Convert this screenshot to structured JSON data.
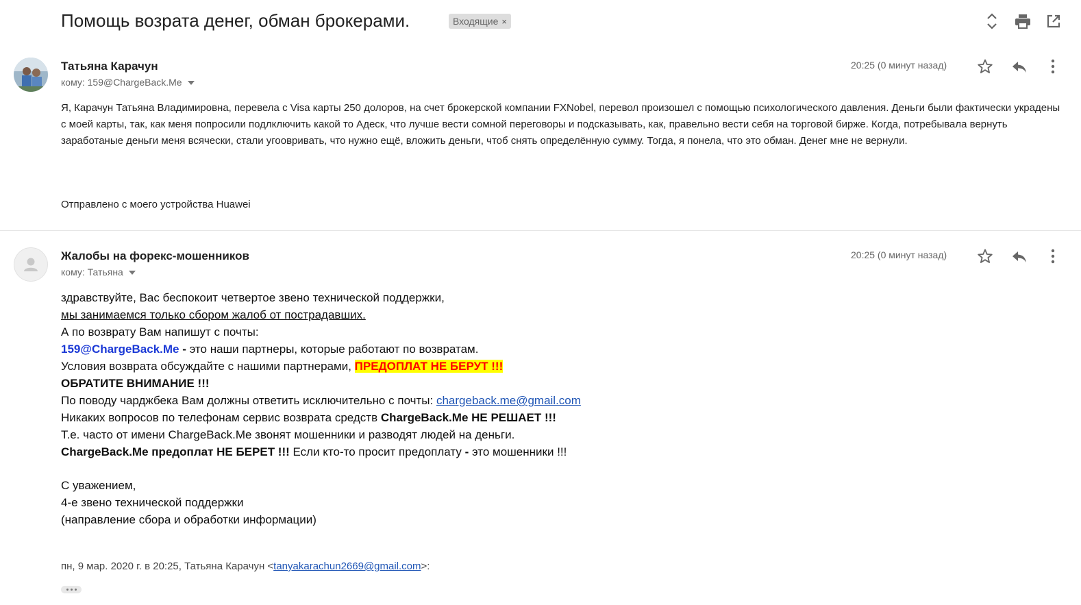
{
  "thread": {
    "subject": "Помощь возрата денег, обман брокерами.",
    "label": "Входящие",
    "label_remove": "×",
    "icons": [
      "expand-collapse-icon",
      "print-icon",
      "open-in-new-window-icon"
    ]
  },
  "messages": [
    {
      "sender": "Татьяна Карачун",
      "to": "кому: 159@ChargeBack.Me",
      "time": "20:25 (0 минут назад)",
      "body": "Я, Карачун Татьяна Владимировна, перевела с Visa карты 250 долоров, на счет брокерской компании FXNobel, перевол произошел с помощью психологического давления. Деньги были фактически украдены с моей карты, так, как меня попросили подлключить какой то Адеск, что лучше вести сомной переговоры и подсказывать, как, правельно вести себя на торговой бирже. Когда, потребывала вернуть заработаные деньги меня всячески, стали угоовривать, что нужно ещё, вложить деньги, чтоб снять определённую сумму. Тогда, я понела, что это обман. Денег мне не вернули.",
      "signature": "Отправлено с моего устройства Huawei"
    },
    {
      "sender": "Жалобы на форекс-мошенников",
      "to": "кому: Татьяна",
      "time": "20:25 (0 минут назад)",
      "lines": {
        "l1": "здравствуйте, Вас беспокоит четвертое звено технической поддержки,",
        "l2": "мы занимаемся только сбором жалоб от пострадавших.",
        "l3": "А по возврату Вам напишут с почты:",
        "l4_email": "159@ChargeBack.Me",
        "l4_dash": " -",
        "l4_rest": " это наши партнеры, которые работают по возвратам.",
        "l5_text": "Условия возврата обсуждайте с нашими партнерами, ",
        "l5_highlight": "ПРЕДОПЛАТ НЕ БЕРУТ !!!",
        "l6": "ОБРАТИТЕ ВНИМАНИЕ !!!",
        "l7_text": "По поводу чарджбека Вам должны ответить исключительно с почты: ",
        "l7_link": "chargeback.me@gmail.com",
        "l8_text": "Никаких вопросов по телефонам сервис возврата средств ",
        "l8_bold": "ChargeBack.Me НЕ РЕШАЕТ !!!",
        "l9": "Т.е. часто от имени ChargeBack.Me звонят мошенники и разводят людей на деньги.",
        "l10_bold": "ChargeBack.Me предоплат НЕ БЕРЕТ !!!",
        "l10_text": " Если кто-то просит предоплату ",
        "l10_dash": "-",
        "l10_rest": " это мошенники !!!",
        "s1": "С уважением,",
        "s2": "4-е звено технической поддержки",
        "s3": "(направление сбора и обработки информации)"
      },
      "quote_prefix": "пн, 9 мар. 2020 г. в 20:25, Татьяна Карачун <",
      "quote_email": "tanyakarachun2669@gmail.com",
      "quote_suffix": ">:"
    }
  ],
  "colors": {
    "link_blue": "#1f55b5",
    "email_blue": "#1b39d6",
    "highlight_bg": "#ffff00",
    "highlight_text": "#ff0000"
  }
}
